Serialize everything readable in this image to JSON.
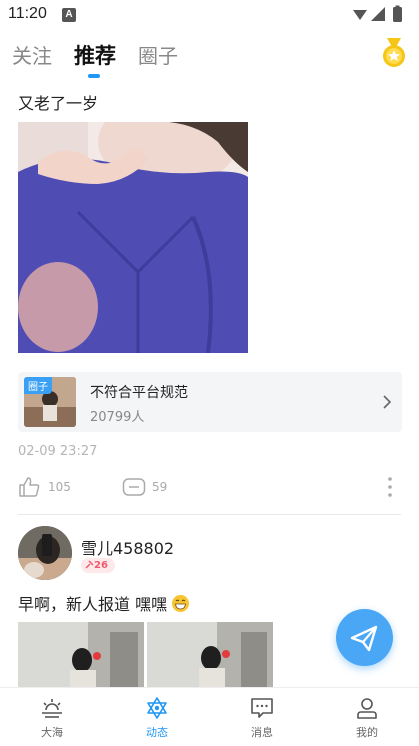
{
  "status_bar": {
    "time": "11:20",
    "notification_badge": "A"
  },
  "top_tabs": [
    {
      "label": "关注",
      "active": false
    },
    {
      "label": "推荐",
      "active": true
    },
    {
      "label": "圈子",
      "active": false
    }
  ],
  "colors": {
    "accent": "#2196f3",
    "fab": "#49a7f5",
    "badge_pink": "#f05a6e",
    "medal": "#f5c518"
  },
  "post1": {
    "text": "又老了一岁",
    "circle": {
      "badge": "圈子",
      "name": "不符合平台规范",
      "members": "20799人"
    },
    "time": "02-09 23:27",
    "likes": "105",
    "comments": "59"
  },
  "post2": {
    "username": "雪儿458802",
    "level": "26",
    "text": "早啊，新人报道 嘿嘿"
  },
  "bottom_nav": [
    {
      "label": "大海",
      "icon": "sunrise-icon"
    },
    {
      "label": "动态",
      "icon": "star-of-david-icon"
    },
    {
      "label": "消息",
      "icon": "message-icon"
    },
    {
      "label": "我的",
      "icon": "person-icon"
    }
  ]
}
